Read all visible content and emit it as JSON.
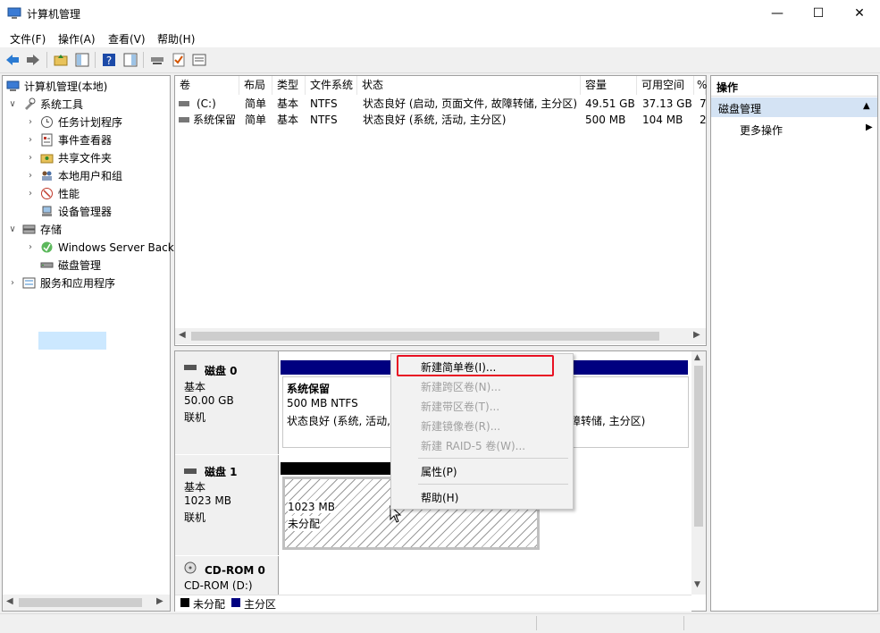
{
  "window": {
    "title": "计算机管理",
    "minimize_icon": "minimize-icon",
    "maximize_icon": "maximize-icon",
    "close_icon": "close-icon"
  },
  "menubar": {
    "items": [
      "文件(F)",
      "操作(A)",
      "查看(V)",
      "帮助(H)"
    ]
  },
  "toolbar": {
    "icons": [
      "back-arrow-icon",
      "forward-arrow-icon",
      "up-folder-icon",
      "show-hide-tree-icon",
      "help-icon",
      "show-hide-action-icon",
      "connect-icon",
      "check-icon",
      "properties-icon"
    ]
  },
  "tree": {
    "root": "计算机管理(本地)",
    "system_tools": "系统工具",
    "task_scheduler": "任务计划程序",
    "event_viewer": "事件查看器",
    "shared_folders": "共享文件夹",
    "local_users": "本地用户和组",
    "performance": "性能",
    "device_manager": "设备管理器",
    "storage": "存储",
    "windows_server_backup": "Windows Server Back",
    "disk_management": "磁盘管理",
    "services_apps": "服务和应用程序"
  },
  "volume_list": {
    "headers": [
      "卷",
      "布局",
      "类型",
      "文件系统",
      "状态",
      "容量",
      "可用空间",
      "%"
    ],
    "rows": [
      {
        "volume": "(C:)",
        "layout": "简单",
        "type": "基本",
        "fs": "NTFS",
        "status": "状态良好 (启动, 页面文件, 故障转储, 主分区)",
        "capacity": "49.51 GB",
        "free": "37.13 GB",
        "pct": "7"
      },
      {
        "volume": "系统保留",
        "layout": "简单",
        "type": "基本",
        "fs": "NTFS",
        "status": "状态良好 (系统, 活动, 主分区)",
        "capacity": "500 MB",
        "free": "104 MB",
        "pct": "2"
      }
    ]
  },
  "disks": {
    "disk0": {
      "name": "磁盘 0",
      "type": "基本",
      "size": "50.00 GB",
      "state": "联机",
      "part1_name": "系统保留",
      "part1_size": "500 MB NTFS",
      "part1_status": "状态良好 (系统, 活动,",
      "part2_status_tail": "障转储, 主分区)"
    },
    "disk1": {
      "name": "磁盘 1",
      "type": "基本",
      "size": "1023 MB",
      "state": "联机",
      "part_size": "1023 MB",
      "part_status": "未分配"
    },
    "cdrom0": {
      "name": "CD-ROM 0",
      "sub": "CD-ROM (D:)"
    },
    "legend": {
      "unallocated": "未分配",
      "primary": "主分区",
      "unallocated_color": "#000000",
      "primary_color": "#000080"
    }
  },
  "context_menu": {
    "new_simple": "新建简单卷(I)...",
    "new_spanned": "新建跨区卷(N)...",
    "new_striped": "新建带区卷(T)...",
    "new_mirrored": "新建镜像卷(R)...",
    "new_raid5": "新建 RAID-5 卷(W)...",
    "properties": "属性(P)",
    "help": "帮助(H)",
    "highlight_color": "#e81123"
  },
  "actions": {
    "header": "操作",
    "section": "磁盘管理",
    "more": "更多操作"
  }
}
